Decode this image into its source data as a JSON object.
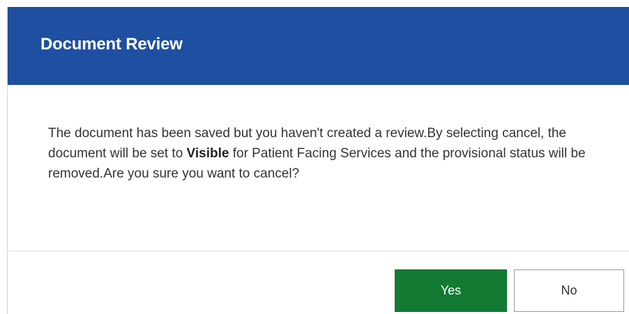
{
  "dialog": {
    "title": "Document Review",
    "message_part1": "The document has been saved but you haven't created a review.By selecting cancel, the document will be set to ",
    "message_bold": "Visible",
    "message_part2": " for Patient Facing Services and the provisional status will be removed.Are you sure you want to cancel?",
    "yes_label": "Yes",
    "no_label": "No"
  },
  "colors": {
    "header_bg": "#1f4fa0",
    "yes_bg": "#137a34"
  }
}
